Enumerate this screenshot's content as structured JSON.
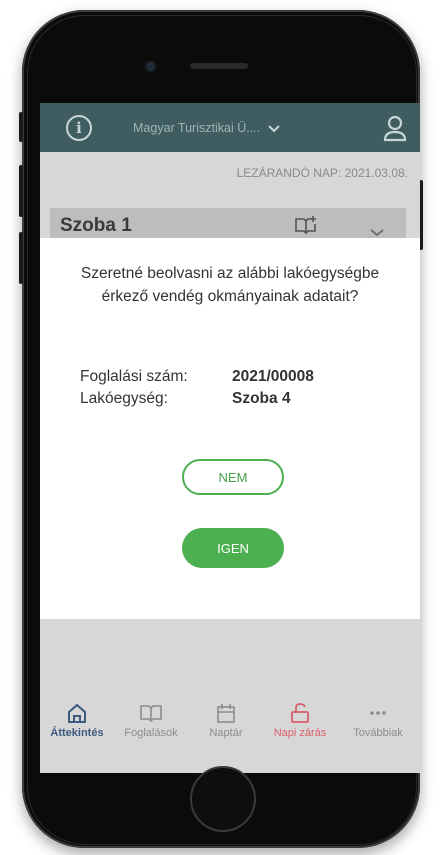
{
  "appbar": {
    "org_name": "Magyar Turisztikai Ü...."
  },
  "page": {
    "closing_day_label": "LEZÁRANDÓ NAP: 2021.03.08.",
    "room_title": "Szoba 1"
  },
  "dialog": {
    "message": "Szeretné beolvasni az alábbi lakóegységbe érkező vendég okmányainak adatait?",
    "booking_label": "Foglalási szám:",
    "booking_value": "2021/00008",
    "unit_label": "Lakóegység:",
    "unit_value": "Szoba 4",
    "no_label": "NEM",
    "yes_label": "IGEN"
  },
  "nav": {
    "items": [
      {
        "label": "Áttekintés",
        "icon": "home-icon"
      },
      {
        "label": "Foglalások",
        "icon": "book-icon"
      },
      {
        "label": "Naptár",
        "icon": "calendar-icon"
      },
      {
        "label": "Napi zárás",
        "icon": "unlock-icon"
      },
      {
        "label": "Továbbiak",
        "icon": "more-icon"
      }
    ]
  },
  "colors": {
    "appbar": "#3f5d61",
    "accent_green": "#4caf50",
    "active_nav": "#3d5a80",
    "close_red": "#d9606b"
  }
}
